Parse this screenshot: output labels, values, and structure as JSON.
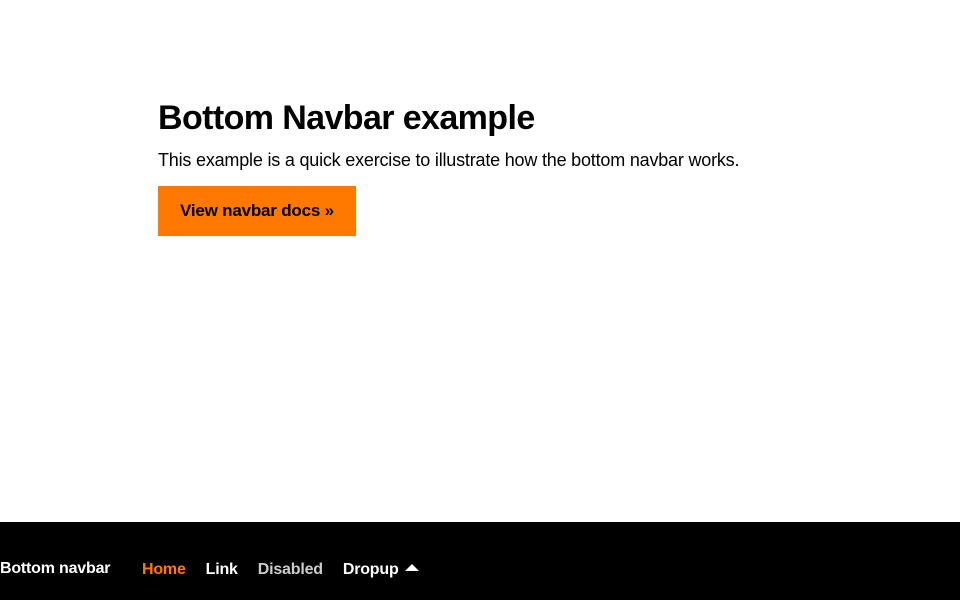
{
  "main": {
    "title": "Bottom Navbar example",
    "lead": "This example is a quick exercise to illustrate how the bottom navbar works.",
    "button_label": "View navbar docs »"
  },
  "navbar": {
    "brand": "Bottom navbar",
    "items": [
      {
        "label": "Home",
        "state": "active"
      },
      {
        "label": "Link",
        "state": "normal"
      },
      {
        "label": "Disabled",
        "state": "disabled"
      },
      {
        "label": "Dropup",
        "state": "normal",
        "icon": "caret-up-icon"
      }
    ]
  },
  "colors": {
    "accent": "#ff7900",
    "navbar_bg": "#000000",
    "disabled": "#cccccc"
  }
}
